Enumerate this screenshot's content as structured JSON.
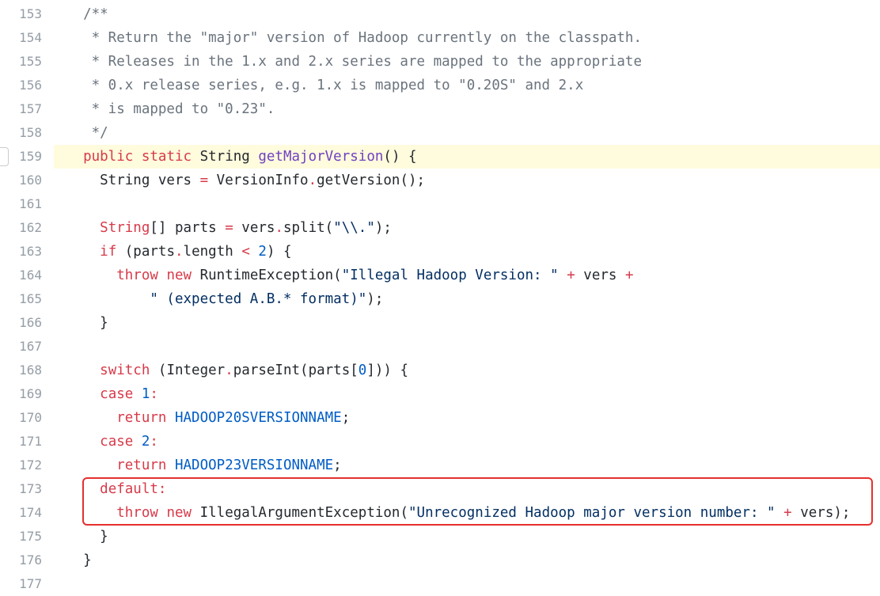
{
  "colors": {
    "keyword": "#d73a49",
    "function": "#6f42c1",
    "string": "#032f62",
    "constant": "#005cc5",
    "comment": "#6a737d",
    "text": "#24292e",
    "line_number": "#959da5",
    "line_highlight": "#fffbdd",
    "annotation_box": "#e5302f"
  },
  "highlighted_line": "159",
  "lines": [
    {
      "num": "153",
      "tokens": [
        {
          "t": "  /**",
          "c": "comment"
        }
      ]
    },
    {
      "num": "154",
      "tokens": [
        {
          "t": "   * Return the \"major\" version of Hadoop currently on the classpath.",
          "c": "comment"
        }
      ]
    },
    {
      "num": "155",
      "tokens": [
        {
          "t": "   * Releases in the 1.x and 2.x series are mapped to the appropriate",
          "c": "comment"
        }
      ]
    },
    {
      "num": "156",
      "tokens": [
        {
          "t": "   * 0.x release series, e.g. 1.x is mapped to \"0.20S\" and 2.x",
          "c": "comment"
        }
      ]
    },
    {
      "num": "157",
      "tokens": [
        {
          "t": "   * is mapped to \"0.23\".",
          "c": "comment"
        }
      ]
    },
    {
      "num": "158",
      "tokens": [
        {
          "t": "   */",
          "c": "comment"
        }
      ]
    },
    {
      "num": "159",
      "tokens": [
        {
          "t": "  ",
          "c": "plain"
        },
        {
          "t": "public",
          "c": "keyword"
        },
        {
          "t": " ",
          "c": "plain"
        },
        {
          "t": "static",
          "c": "keyword"
        },
        {
          "t": " String ",
          "c": "plain"
        },
        {
          "t": "getMajorVersion",
          "c": "func"
        },
        {
          "t": "() {",
          "c": "plain"
        }
      ]
    },
    {
      "num": "160",
      "tokens": [
        {
          "t": "    String vers ",
          "c": "plain"
        },
        {
          "t": "=",
          "c": "keyword"
        },
        {
          "t": " VersionInfo",
          "c": "plain"
        },
        {
          "t": ".",
          "c": "keyword"
        },
        {
          "t": "getVersion();",
          "c": "plain"
        }
      ]
    },
    {
      "num": "161",
      "tokens": []
    },
    {
      "num": "162",
      "tokens": [
        {
          "t": "    ",
          "c": "plain"
        },
        {
          "t": "String",
          "c": "keyword"
        },
        {
          "t": "[] parts ",
          "c": "plain"
        },
        {
          "t": "=",
          "c": "keyword"
        },
        {
          "t": " vers",
          "c": "plain"
        },
        {
          "t": ".",
          "c": "keyword"
        },
        {
          "t": "split(",
          "c": "plain"
        },
        {
          "t": "\"\\\\.\"",
          "c": "string"
        },
        {
          "t": ");",
          "c": "plain"
        }
      ]
    },
    {
      "num": "163",
      "tokens": [
        {
          "t": "    ",
          "c": "plain"
        },
        {
          "t": "if",
          "c": "keyword"
        },
        {
          "t": " (parts",
          "c": "plain"
        },
        {
          "t": ".",
          "c": "keyword"
        },
        {
          "t": "length ",
          "c": "plain"
        },
        {
          "t": "<",
          "c": "keyword"
        },
        {
          "t": " ",
          "c": "plain"
        },
        {
          "t": "2",
          "c": "const"
        },
        {
          "t": ") {",
          "c": "plain"
        }
      ]
    },
    {
      "num": "164",
      "tokens": [
        {
          "t": "      ",
          "c": "plain"
        },
        {
          "t": "throw",
          "c": "keyword"
        },
        {
          "t": " ",
          "c": "plain"
        },
        {
          "t": "new",
          "c": "keyword"
        },
        {
          "t": " RuntimeException(",
          "c": "plain"
        },
        {
          "t": "\"Illegal Hadoop Version: \"",
          "c": "string"
        },
        {
          "t": " ",
          "c": "plain"
        },
        {
          "t": "+",
          "c": "keyword"
        },
        {
          "t": " vers ",
          "c": "plain"
        },
        {
          "t": "+",
          "c": "keyword"
        }
      ]
    },
    {
      "num": "165",
      "tokens": [
        {
          "t": "          ",
          "c": "plain"
        },
        {
          "t": "\" (expected A.B.* format)\"",
          "c": "string"
        },
        {
          "t": ");",
          "c": "plain"
        }
      ]
    },
    {
      "num": "166",
      "tokens": [
        {
          "t": "    }",
          "c": "plain"
        }
      ]
    },
    {
      "num": "167",
      "tokens": []
    },
    {
      "num": "168",
      "tokens": [
        {
          "t": "    ",
          "c": "plain"
        },
        {
          "t": "switch",
          "c": "keyword"
        },
        {
          "t": " (Integer",
          "c": "plain"
        },
        {
          "t": ".",
          "c": "keyword"
        },
        {
          "t": "parseInt(parts[",
          "c": "plain"
        },
        {
          "t": "0",
          "c": "const"
        },
        {
          "t": "])) {",
          "c": "plain"
        }
      ]
    },
    {
      "num": "169",
      "tokens": [
        {
          "t": "    ",
          "c": "plain"
        },
        {
          "t": "case",
          "c": "keyword"
        },
        {
          "t": " ",
          "c": "plain"
        },
        {
          "t": "1",
          "c": "const"
        },
        {
          "t": ":",
          "c": "keyword"
        }
      ]
    },
    {
      "num": "170",
      "tokens": [
        {
          "t": "      ",
          "c": "plain"
        },
        {
          "t": "return",
          "c": "keyword"
        },
        {
          "t": " ",
          "c": "plain"
        },
        {
          "t": "HADOOP20SVERSIONNAME",
          "c": "const"
        },
        {
          "t": ";",
          "c": "plain"
        }
      ]
    },
    {
      "num": "171",
      "tokens": [
        {
          "t": "    ",
          "c": "plain"
        },
        {
          "t": "case",
          "c": "keyword"
        },
        {
          "t": " ",
          "c": "plain"
        },
        {
          "t": "2",
          "c": "const"
        },
        {
          "t": ":",
          "c": "keyword"
        }
      ]
    },
    {
      "num": "172",
      "tokens": [
        {
          "t": "      ",
          "c": "plain"
        },
        {
          "t": "return",
          "c": "keyword"
        },
        {
          "t": " ",
          "c": "plain"
        },
        {
          "t": "HADOOP23VERSIONNAME",
          "c": "const"
        },
        {
          "t": ";",
          "c": "plain"
        }
      ]
    },
    {
      "num": "173",
      "tokens": [
        {
          "t": "    ",
          "c": "plain"
        },
        {
          "t": "default",
          "c": "keyword"
        },
        {
          "t": ":",
          "c": "keyword"
        }
      ]
    },
    {
      "num": "174",
      "tokens": [
        {
          "t": "      ",
          "c": "plain"
        },
        {
          "t": "throw",
          "c": "keyword"
        },
        {
          "t": " ",
          "c": "plain"
        },
        {
          "t": "new",
          "c": "keyword"
        },
        {
          "t": " IllegalArgumentException(",
          "c": "plain"
        },
        {
          "t": "\"Unrecognized Hadoop major version number: \"",
          "c": "string"
        },
        {
          "t": " ",
          "c": "plain"
        },
        {
          "t": "+",
          "c": "keyword"
        },
        {
          "t": " vers);",
          "c": "plain"
        }
      ]
    },
    {
      "num": "175",
      "tokens": [
        {
          "t": "    }",
          "c": "plain"
        }
      ]
    },
    {
      "num": "176",
      "tokens": [
        {
          "t": "  }",
          "c": "plain"
        }
      ]
    },
    {
      "num": "177",
      "tokens": []
    }
  ]
}
